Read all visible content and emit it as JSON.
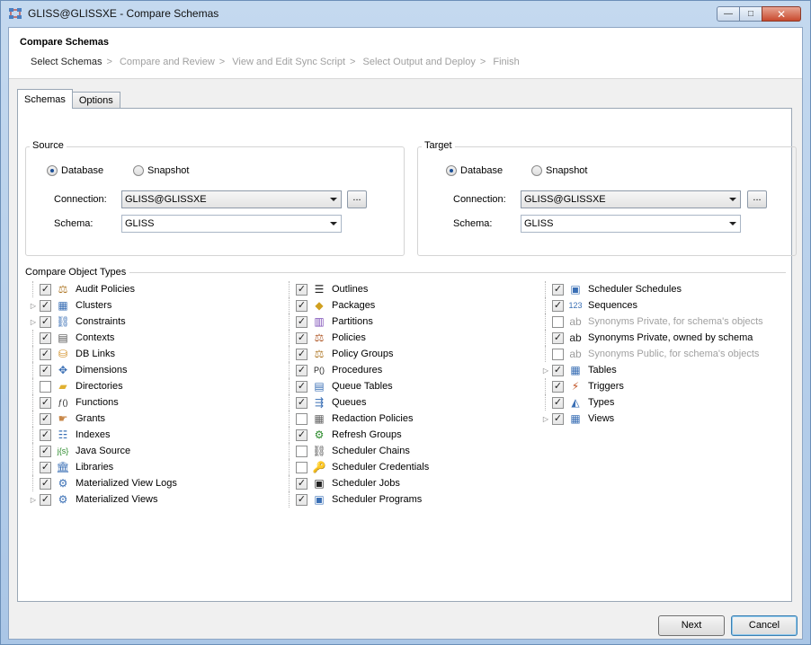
{
  "window": {
    "title": "GLISS@GLISSXE - Compare Schemas",
    "min_label": "—",
    "max_label": "□",
    "close_label": "✕"
  },
  "header": {
    "title": "Compare Schemas",
    "steps": [
      {
        "label": "Select Schemas",
        "current": true
      },
      {
        "label": "Compare and Review",
        "current": false
      },
      {
        "label": "View and Edit Sync Script",
        "current": false
      },
      {
        "label": "Select Output and Deploy",
        "current": false
      },
      {
        "label": "Finish",
        "current": false
      }
    ],
    "separator": ">"
  },
  "tabs": [
    {
      "label": "Schemas",
      "active": true
    },
    {
      "label": "Options",
      "active": false
    }
  ],
  "source": {
    "label": "Source",
    "radio_database": "Database",
    "radio_snapshot": "Snapshot",
    "selected": "Database",
    "connection_label": "Connection:",
    "connection_value": "GLISS@GLISSXE",
    "schema_label": "Schema:",
    "schema_value": "GLISS",
    "browse_label": "..."
  },
  "target": {
    "label": "Target",
    "radio_database": "Database",
    "radio_snapshot": "Snapshot",
    "selected": "Database",
    "connection_label": "Connection:",
    "connection_value": "GLISS@GLISSXE",
    "schema_label": "Schema:",
    "schema_value": "GLISS",
    "browse_label": "..."
  },
  "object_types": {
    "label": "Compare Object Types",
    "columns": [
      [
        {
          "label": "Audit Policies",
          "checked": true,
          "expandable": false,
          "enabled": true,
          "icon": "audit-policies-icon",
          "glyph": "⚖",
          "color": "#b07a2a"
        },
        {
          "label": "Clusters",
          "checked": true,
          "expandable": true,
          "enabled": true,
          "icon": "clusters-icon",
          "glyph": "▦",
          "color": "#3a6fb5"
        },
        {
          "label": "Constraints",
          "checked": true,
          "expandable": true,
          "enabled": true,
          "icon": "constraints-icon",
          "glyph": "⛓",
          "color": "#3a6fb5"
        },
        {
          "label": "Contexts",
          "checked": true,
          "expandable": false,
          "enabled": true,
          "icon": "contexts-icon",
          "glyph": "▤",
          "color": "#555"
        },
        {
          "label": "DB Links",
          "checked": true,
          "expandable": false,
          "enabled": true,
          "icon": "db-links-icon",
          "glyph": "⛁",
          "color": "#d08a1a"
        },
        {
          "label": "Dimensions",
          "checked": true,
          "expandable": false,
          "enabled": true,
          "icon": "dimensions-icon",
          "glyph": "✥",
          "color": "#3a6fb5"
        },
        {
          "label": "Directories",
          "checked": false,
          "expandable": false,
          "enabled": true,
          "icon": "directories-icon",
          "glyph": "▰",
          "color": "#e0b030"
        },
        {
          "label": "Functions",
          "checked": true,
          "expandable": false,
          "enabled": true,
          "icon": "functions-icon",
          "glyph": "ƒ()",
          "color": "#222"
        },
        {
          "label": "Grants",
          "checked": true,
          "expandable": false,
          "enabled": true,
          "icon": "grants-icon",
          "glyph": "☛",
          "color": "#c8884a"
        },
        {
          "label": "Indexes",
          "checked": true,
          "expandable": false,
          "enabled": true,
          "icon": "indexes-icon",
          "glyph": "☷",
          "color": "#3a6fb5"
        },
        {
          "label": "Java Source",
          "checked": true,
          "expandable": false,
          "enabled": true,
          "icon": "java-source-icon",
          "glyph": "j{s}",
          "color": "#2a8a2a"
        },
        {
          "label": "Libraries",
          "checked": true,
          "expandable": false,
          "enabled": true,
          "icon": "libraries-icon",
          "glyph": "🏛",
          "color": "#3a6fb5"
        },
        {
          "label": "Materialized View Logs",
          "checked": true,
          "expandable": false,
          "enabled": true,
          "icon": "materialized-view-logs-icon",
          "glyph": "⚙",
          "color": "#3a6fb5"
        },
        {
          "label": "Materialized Views",
          "checked": true,
          "expandable": true,
          "enabled": true,
          "icon": "materialized-views-icon",
          "glyph": "⚙",
          "color": "#3a6fb5"
        }
      ],
      [
        {
          "label": "Outlines",
          "checked": true,
          "expandable": false,
          "enabled": true,
          "icon": "outlines-icon",
          "glyph": "☰",
          "color": "#222"
        },
        {
          "label": "Packages",
          "checked": true,
          "expandable": false,
          "enabled": true,
          "icon": "packages-icon",
          "glyph": "◆",
          "color": "#d0a020"
        },
        {
          "label": "Partitions",
          "checked": true,
          "expandable": false,
          "enabled": true,
          "icon": "partitions-icon",
          "glyph": "▥",
          "color": "#7a4ab5"
        },
        {
          "label": "Policies",
          "checked": true,
          "expandable": false,
          "enabled": true,
          "icon": "policies-icon",
          "glyph": "⚖",
          "color": "#b05a2a"
        },
        {
          "label": "Policy Groups",
          "checked": true,
          "expandable": false,
          "enabled": true,
          "icon": "policy-groups-icon",
          "glyph": "⚖",
          "color": "#b07a2a"
        },
        {
          "label": "Procedures",
          "checked": true,
          "expandable": false,
          "enabled": true,
          "icon": "procedures-icon",
          "glyph": "P()",
          "color": "#222"
        },
        {
          "label": "Queue Tables",
          "checked": true,
          "expandable": false,
          "enabled": true,
          "icon": "queue-tables-icon",
          "glyph": "▤",
          "color": "#3a6fb5"
        },
        {
          "label": "Queues",
          "checked": true,
          "expandable": false,
          "enabled": true,
          "icon": "queues-icon",
          "glyph": "⇶",
          "color": "#3a6fb5"
        },
        {
          "label": "Redaction Policies",
          "checked": false,
          "expandable": false,
          "enabled": true,
          "icon": "redaction-policies-icon",
          "glyph": "▦",
          "color": "#666"
        },
        {
          "label": "Refresh Groups",
          "checked": true,
          "expandable": false,
          "enabled": true,
          "icon": "refresh-groups-icon",
          "glyph": "⚙",
          "color": "#2a8a2a"
        },
        {
          "label": "Scheduler Chains",
          "checked": false,
          "expandable": false,
          "enabled": true,
          "icon": "scheduler-chains-icon",
          "glyph": "⛓",
          "color": "#555"
        },
        {
          "label": "Scheduler Credentials",
          "checked": false,
          "expandable": false,
          "enabled": true,
          "icon": "scheduler-credentials-icon",
          "glyph": "🔑",
          "color": "#d0a020"
        },
        {
          "label": "Scheduler Jobs",
          "checked": true,
          "expandable": false,
          "enabled": true,
          "icon": "scheduler-jobs-icon",
          "glyph": "▣",
          "color": "#222"
        },
        {
          "label": "Scheduler Programs",
          "checked": true,
          "expandable": false,
          "enabled": true,
          "icon": "scheduler-programs-icon",
          "glyph": "▣",
          "color": "#3a6fb5"
        }
      ],
      [
        {
          "label": "Scheduler Schedules",
          "checked": true,
          "expandable": false,
          "enabled": true,
          "icon": "scheduler-schedules-icon",
          "glyph": "▣",
          "color": "#3a6fb5"
        },
        {
          "label": "Sequences",
          "checked": true,
          "expandable": false,
          "enabled": true,
          "icon": "sequences-icon",
          "glyph": "123",
          "color": "#3a6fb5"
        },
        {
          "label": "Synonyms Private, for schema's objects",
          "checked": false,
          "expandable": false,
          "enabled": false,
          "icon": "synonyms-private-schema-objects-icon",
          "glyph": "ab",
          "color": "#222"
        },
        {
          "label": "Synonyms Private, owned by schema",
          "checked": true,
          "expandable": false,
          "enabled": true,
          "icon": "synonyms-private-owned-icon",
          "glyph": "ab",
          "color": "#222"
        },
        {
          "label": "Synonyms Public, for schema's objects",
          "checked": false,
          "expandable": false,
          "enabled": false,
          "icon": "synonyms-public-icon",
          "glyph": "ab",
          "color": "#222"
        },
        {
          "label": "Tables",
          "checked": true,
          "expandable": true,
          "enabled": true,
          "icon": "tables-icon",
          "glyph": "▦",
          "color": "#3a6fb5"
        },
        {
          "label": "Triggers",
          "checked": true,
          "expandable": false,
          "enabled": true,
          "icon": "triggers-icon",
          "glyph": "⚡",
          "color": "#c05020"
        },
        {
          "label": "Types",
          "checked": true,
          "expandable": false,
          "enabled": true,
          "icon": "types-icon",
          "glyph": "◭",
          "color": "#3a6fb5"
        },
        {
          "label": "Views",
          "checked": true,
          "expandable": true,
          "enabled": true,
          "icon": "views-icon",
          "glyph": "▦",
          "color": "#3a6fb5"
        }
      ]
    ]
  },
  "footer": {
    "next_label": "Next",
    "cancel_label": "Cancel"
  }
}
